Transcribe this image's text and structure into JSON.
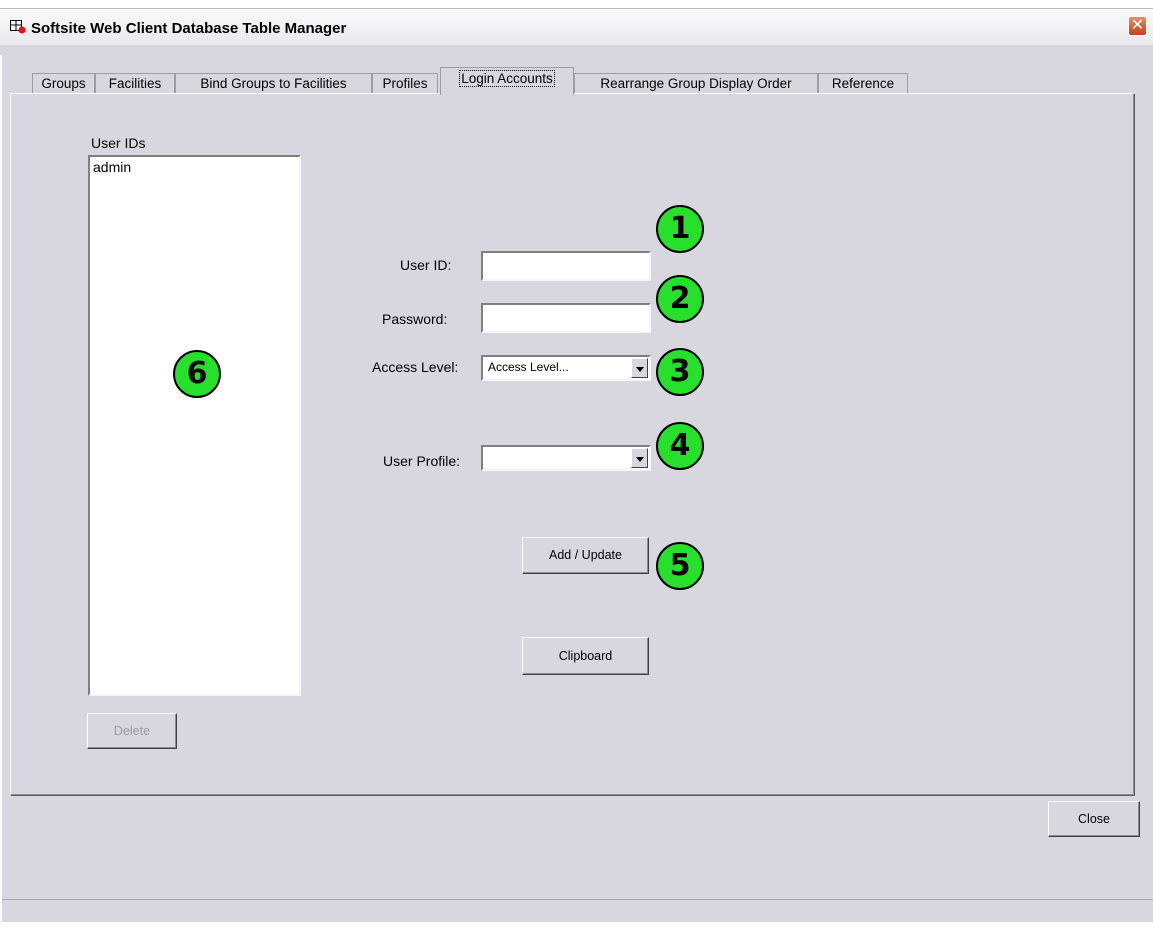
{
  "window": {
    "title": "Softsite Web Client Database Table Manager"
  },
  "tabs": [
    {
      "label": "Groups"
    },
    {
      "label": "Facilities"
    },
    {
      "label": "Bind Groups to Facilities"
    },
    {
      "label": "Profiles"
    },
    {
      "label": "Login Accounts",
      "active": true
    },
    {
      "label": "Rearrange Group Display Order"
    },
    {
      "label": "Reference"
    }
  ],
  "user_list": {
    "header": "User IDs",
    "items": [
      "admin"
    ]
  },
  "form": {
    "user_id_label": "User ID:",
    "user_id_value": "",
    "password_label": "Password:",
    "password_value": "",
    "access_level_label": "Access Level:",
    "access_level_value": "Access Level...",
    "user_profile_label": "User Profile:",
    "user_profile_value": ""
  },
  "buttons": {
    "add_update": "Add / Update",
    "clipboard": "Clipboard",
    "delete": "Delete",
    "close": "Close"
  },
  "callouts": [
    "1",
    "2",
    "3",
    "4",
    "5",
    "6"
  ],
  "colors": {
    "callout_fill": "#26e02b",
    "window_bg": "#d8d7e0",
    "close_button": "#c0431b"
  }
}
